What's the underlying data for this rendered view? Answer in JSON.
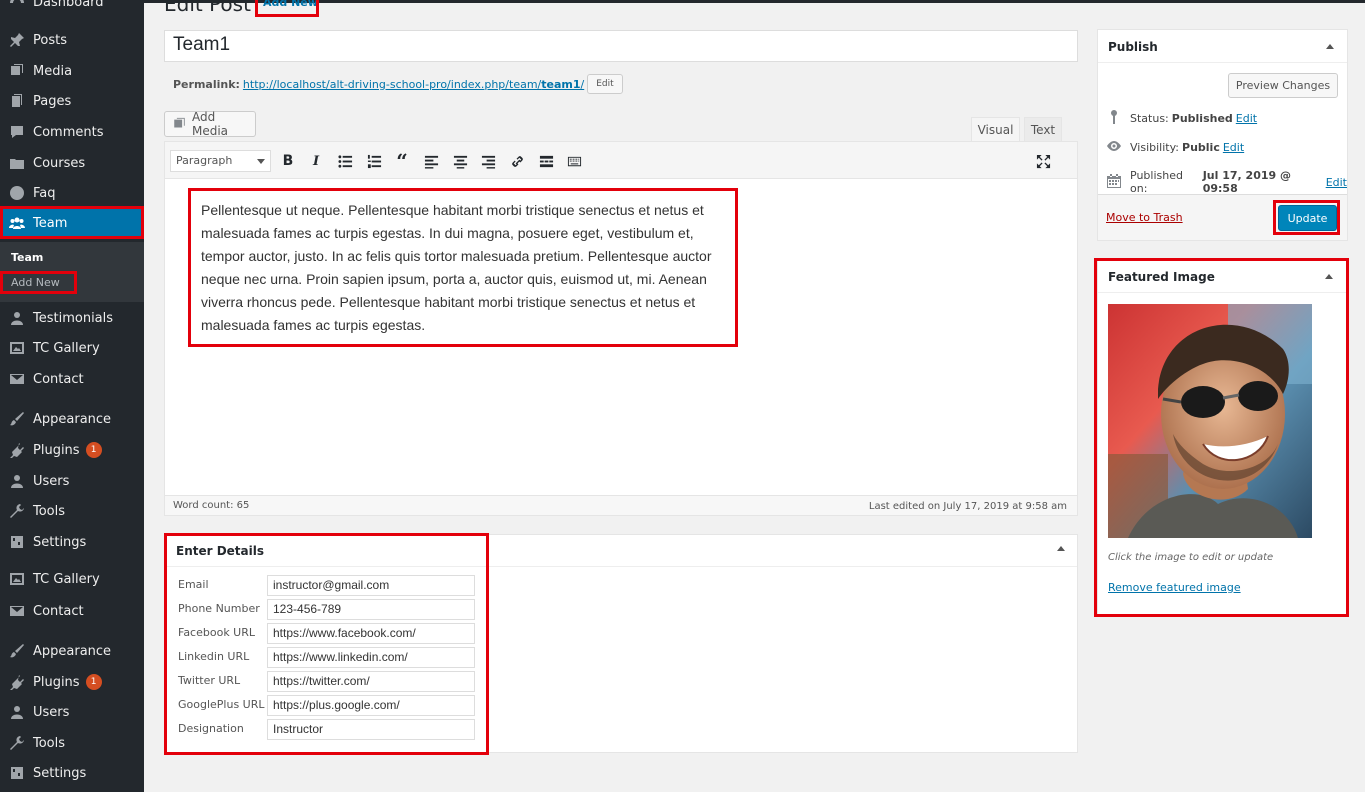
{
  "sidebar": {
    "items": [
      {
        "label": "Dashboard",
        "icon": "dashboard-icon"
      },
      {
        "label": "Posts",
        "icon": "pin-icon"
      },
      {
        "label": "Media",
        "icon": "media-icon"
      },
      {
        "label": "Pages",
        "icon": "pages-icon"
      },
      {
        "label": "Comments",
        "icon": "comment-icon"
      },
      {
        "label": "Courses",
        "icon": "folder-icon"
      },
      {
        "label": "Faq",
        "icon": "help-icon"
      },
      {
        "label": "Team",
        "icon": "groups-icon"
      },
      {
        "label": "Testimonials",
        "icon": "person-icon"
      },
      {
        "label": "TC Gallery",
        "icon": "gallery-icon"
      },
      {
        "label": "Contact",
        "icon": "envelope-icon"
      },
      {
        "label": "Appearance",
        "icon": "brush-icon"
      },
      {
        "label": "Plugins",
        "icon": "plugin-icon",
        "badge": "1"
      },
      {
        "label": "Users",
        "icon": "users-icon"
      },
      {
        "label": "Tools",
        "icon": "wrench-icon"
      },
      {
        "label": "Settings",
        "icon": "settings-icon"
      },
      {
        "label": "TC Gallery",
        "icon": "gallery-icon"
      },
      {
        "label": "Contact",
        "icon": "envelope-icon"
      },
      {
        "label": "Appearance",
        "icon": "brush-icon"
      },
      {
        "label": "Plugins",
        "icon": "plugin-icon",
        "badge": "1"
      },
      {
        "label": "Users",
        "icon": "users-icon"
      },
      {
        "label": "Tools",
        "icon": "wrench-icon"
      },
      {
        "label": "Settings",
        "icon": "settings-icon"
      }
    ],
    "submenu": {
      "current": "Team",
      "add_new": "Add New"
    }
  },
  "header": {
    "title": "Edit Post",
    "add_new": "Add New"
  },
  "post": {
    "title": "Team1",
    "permalink_label": "Permalink:",
    "permalink_base": "http://localhost/alt-driving-school-pro/index.php/team/",
    "permalink_slug": "team1",
    "permalink_suffix": "/",
    "edit_label": "Edit"
  },
  "editor": {
    "add_media": "Add Media",
    "tab_visual": "Visual",
    "tab_text": "Text",
    "format": "Paragraph",
    "content": "Pellentesque ut neque. Pellentesque habitant morbi tristique senectus et netus et malesuada fames ac turpis egestas. In dui magna, posuere eget, vestibulum et, tempor auctor, justo. In ac felis quis tortor malesuada pretium. Pellentesque auctor neque nec urna. Proin sapien ipsum, porta a, auctor quis, euismod ut, mi. Aenean viverra rhoncus pede. Pellentesque habitant morbi tristique senectus et netus et malesuada fames ac turpis egestas.",
    "word_count": "Word count: 65",
    "last_edited": "Last edited on July 17, 2019 at 9:58 am"
  },
  "details": {
    "title": "Enter Details",
    "fields": [
      {
        "label": "Email",
        "value": "instructor@gmail.com"
      },
      {
        "label": "Phone Number",
        "value": "123-456-789"
      },
      {
        "label": "Facebook URL",
        "value": "https://www.facebook.com/"
      },
      {
        "label": "Linkedin URL",
        "value": "https://www.linkedin.com/"
      },
      {
        "label": "Twitter URL",
        "value": "https://twitter.com/"
      },
      {
        "label": "GooglePlus URL",
        "value": "https://plus.google.com/"
      },
      {
        "label": "Designation",
        "value": "Instructor"
      }
    ]
  },
  "publish": {
    "title": "Publish",
    "preview": "Preview Changes",
    "status_label": "Status:",
    "status_value": "Published",
    "visibility_label": "Visibility:",
    "visibility_value": "Public",
    "published_label": "Published on:",
    "published_value": "Jul 17, 2019 @ 09:58",
    "edit": "Edit",
    "trash": "Move to Trash",
    "update": "Update"
  },
  "featured": {
    "title": "Featured Image",
    "hint": "Click the image to edit or update",
    "remove": "Remove featured image"
  },
  "colors": {
    "accent": "#0073aa",
    "sidebar": "#23282d",
    "highlight_box": "#e3000b"
  }
}
